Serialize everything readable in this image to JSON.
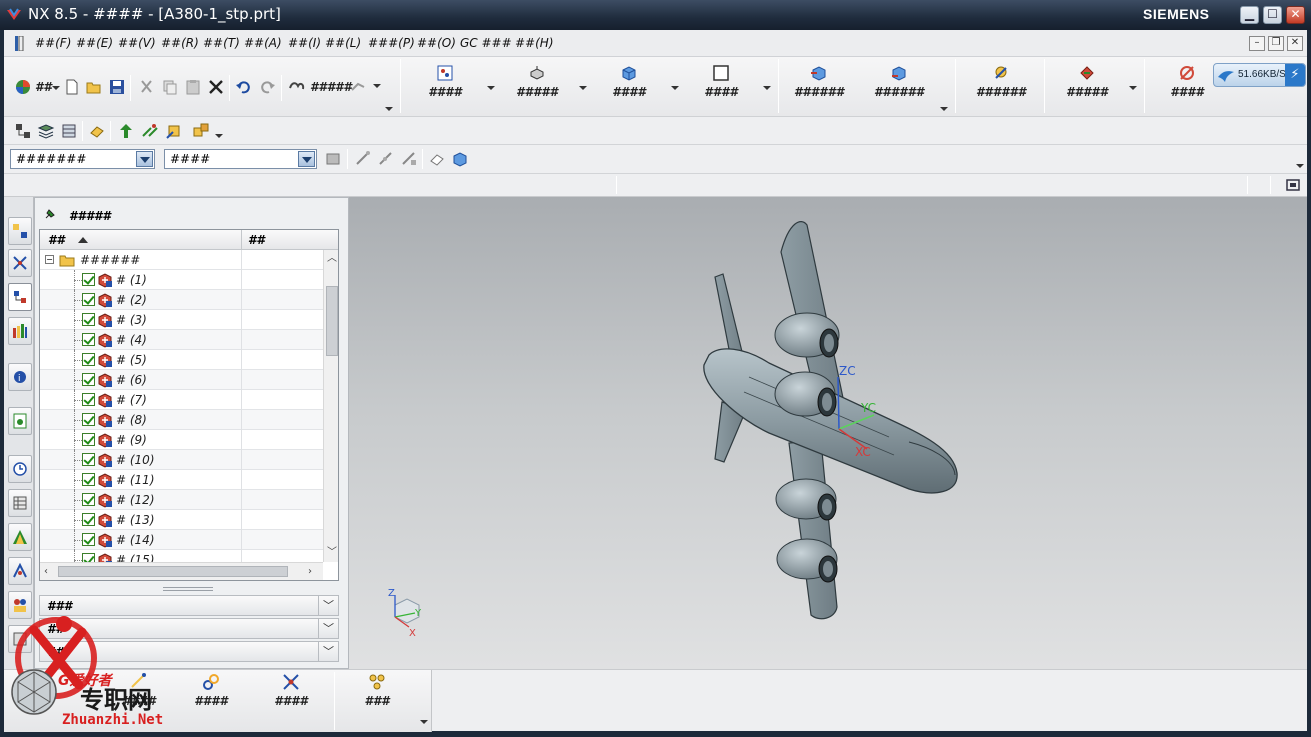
{
  "titlebar": {
    "title": "NX 8.5 - #### - [A380-1_stp.prt]",
    "brand": "SIEMENS",
    "minimize": "▁",
    "maximize": "☐",
    "close": "✕"
  },
  "menubar": {
    "items": [
      "##(F)",
      "##(E)",
      "##(V)",
      "##(R)",
      "##(T)",
      "##(A)",
      "##(I)",
      "##(L)",
      "###(P)",
      "##(O)",
      "GC ###",
      "##(H)"
    ],
    "mdi_minimize": "–",
    "mdi_restore": "❐",
    "mdi_close": "✕"
  },
  "toolbar1": {
    "start_label": "##",
    "touch_label": "#####",
    "buttons": [
      "####",
      "#####",
      "####",
      "####",
      "######",
      "######",
      "######",
      "#####",
      "####"
    ]
  },
  "speed_widget": {
    "text": "51.66KB/S",
    "bolt": "⚡"
  },
  "selection_bar": {
    "filter_value": "#######",
    "scope_value": "####"
  },
  "navigator": {
    "title": "#####",
    "col_name": "##",
    "col_other": "##",
    "root_label": "######",
    "items": [
      "# (1)",
      "# (2)",
      "# (3)",
      "# (4)",
      "# (5)",
      "# (6)",
      "# (7)",
      "# (8)",
      "# (9)",
      "# (10)",
      "# (11)",
      "# (12)",
      "# (13)",
      "# (14)",
      "# (15)"
    ],
    "panels": [
      "###",
      "##",
      "##"
    ]
  },
  "viewport": {
    "wcs_labels": {
      "zc": "ZC",
      "yc": "YC",
      "xc": "XC"
    },
    "triad_labels": {
      "z": "Z",
      "y": "Y",
      "x": "X"
    }
  },
  "bottom_toolbar": {
    "buttons": [
      "####",
      "####",
      "####",
      "###"
    ]
  },
  "watermark": {
    "brand": "G爱好者",
    "site_cn": "专职网",
    "site_url": "Zhuanzhi.Net"
  },
  "colors": {
    "titlebar": "#1f2c3d",
    "toolbar_bg": "#eeeff1",
    "viewport_top": "#a9adb1",
    "viewport_bottom": "#e0e1e2",
    "model_gray": "#7d8b92",
    "accent_blue": "#2b78c9"
  }
}
